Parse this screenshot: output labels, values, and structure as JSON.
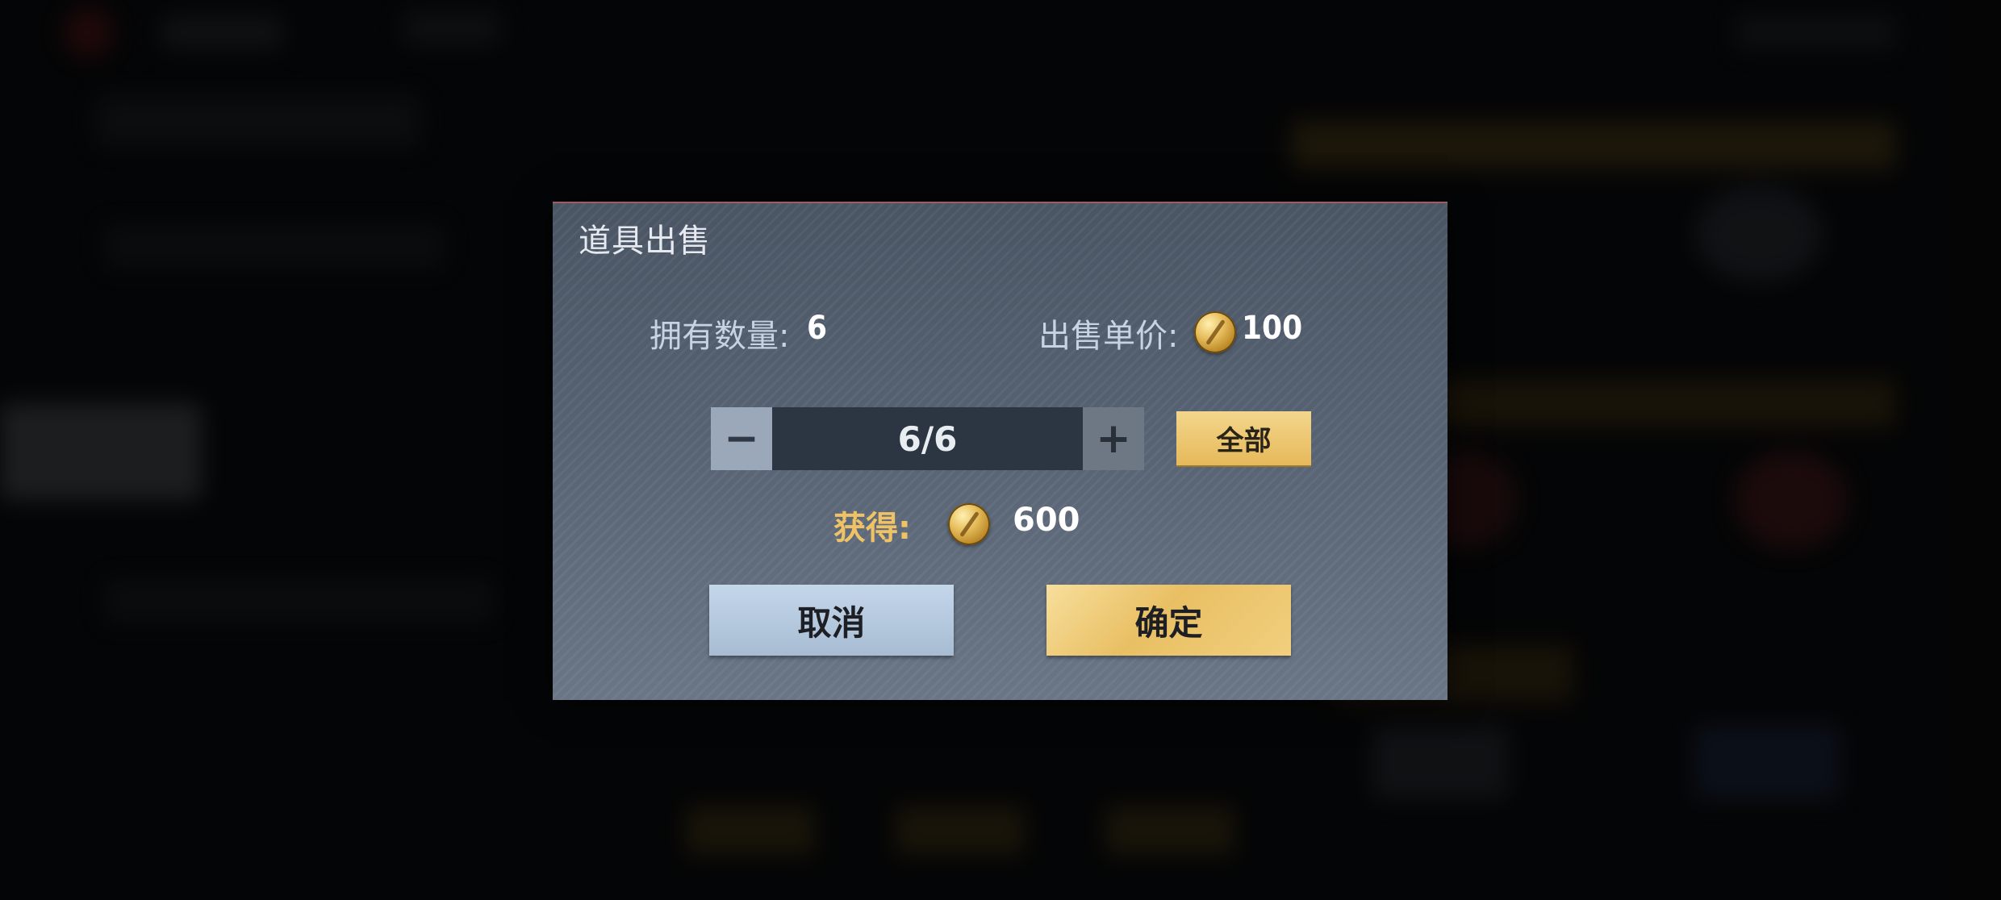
{
  "dialog": {
    "title": "道具出售",
    "owned_label": "拥有数量:",
    "owned_value": "6",
    "price_label": "出售单价:",
    "price_value": "100",
    "quantity_display": "6/6",
    "minus_symbol": "−",
    "plus_symbol": "+",
    "all_label": "全部",
    "gain_label": "获得:",
    "gain_value": "600",
    "cancel_label": "取消",
    "confirm_label": "确定",
    "coin_icon": "gold-coin-icon"
  },
  "colors": {
    "accent_gold": "#e9bf63",
    "cancel_blue": "#b8cbe0",
    "gain_label_color": "#f0c266",
    "dialog_bg": "#566272"
  }
}
